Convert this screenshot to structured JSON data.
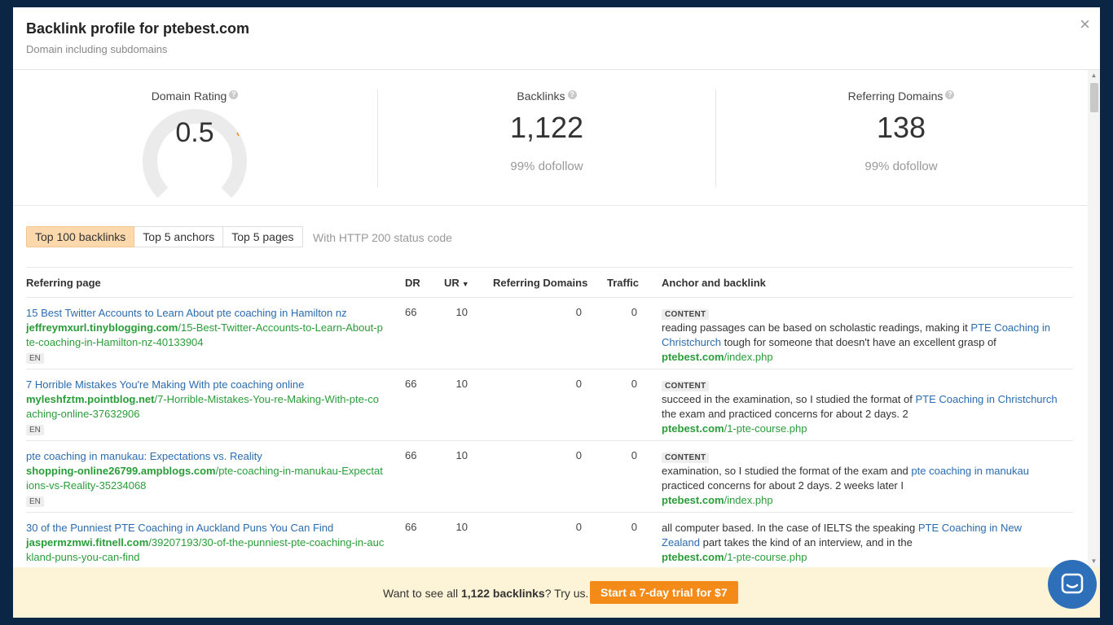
{
  "header": {
    "title": "Backlink profile for ptebest.com",
    "subtitle": "Domain including subdomains",
    "close_icon": "×"
  },
  "metrics": {
    "domain_rating": {
      "label": "Domain Rating",
      "value": "0.5",
      "gauge_fraction": 0.005
    },
    "backlinks": {
      "label": "Backlinks",
      "value": "1,122",
      "sub": "99% dofollow"
    },
    "referring_domains": {
      "label": "Referring Domains",
      "value": "138",
      "sub": "99% dofollow"
    },
    "help_glyph": "?"
  },
  "tabs": [
    {
      "label": "Top 100 backlinks",
      "active": true
    },
    {
      "label": "Top 5 anchors",
      "active": false
    },
    {
      "label": "Top 5 pages",
      "active": false
    }
  ],
  "tab_note": "With HTTP 200 status code",
  "table": {
    "headers": {
      "referring_page": "Referring page",
      "dr": "DR",
      "ur": "UR",
      "referring_domains": "Referring Domains",
      "traffic": "Traffic",
      "anchor": "Anchor and backlink"
    },
    "rows": [
      {
        "title": "15 Best Twitter Accounts to Learn About pte coaching in Hamilton nz",
        "domain": "jeffreymxurl.tinyblogging.com",
        "path": "/15-Best-Twitter-Accounts-to-Learn-About-pte-coaching-in-Hamilton-nz-40133904",
        "lang": "EN",
        "dr": "66",
        "ur": "10",
        "rd": "0",
        "traffic": "0",
        "badge": "CONTENT",
        "text_before": "reading passages can be based on scholastic readings, making it ",
        "anchor": "PTE Coaching in Christchurch",
        "text_after": " tough for someone that doesn't have an excellent grasp of",
        "bl_domain": "ptebest.com",
        "bl_path": "/index.php"
      },
      {
        "title": "7 Horrible Mistakes You're Making With pte coaching online",
        "domain": "myleshfztm.pointblog.net",
        "path": "/7-Horrible-Mistakes-You-re-Making-With-pte-coaching-online-37632906",
        "lang": "EN",
        "dr": "66",
        "ur": "10",
        "rd": "0",
        "traffic": "0",
        "badge": "CONTENT",
        "text_before": "succeed in the examination, so I studied the format of ",
        "anchor": "PTE Coaching in Christchurch",
        "text_after": " the exam and practiced concerns for about 2 days. 2",
        "bl_domain": "ptebest.com",
        "bl_path": "/1-pte-course.php"
      },
      {
        "title": "pte coaching in manukau: Expectations vs. Reality",
        "domain": "shopping-online26799.ampblogs.com",
        "path": "/pte-coaching-in-manukau-Expectations-vs-Reality-35234068",
        "lang": "EN",
        "dr": "66",
        "ur": "10",
        "rd": "0",
        "traffic": "0",
        "badge": "CONTENT",
        "text_before": "examination, so I studied the format of the exam and ",
        "anchor": "pte coaching in manukau",
        "text_after": " practiced concerns for about 2 days. 2 weeks later I",
        "bl_domain": "ptebest.com",
        "bl_path": "/index.php"
      },
      {
        "title": "30 of the Punniest PTE Coaching in Auckland Puns You Can Find",
        "domain": "jaspermzmwi.fitnell.com",
        "path": "/39207193/30-of-the-punniest-pte-coaching-in-auckland-puns-you-can-find",
        "lang": "",
        "dr": "66",
        "ur": "10",
        "rd": "0",
        "traffic": "0",
        "badge": "",
        "text_before": "all computer based. In the case of IELTS the speaking ",
        "anchor": "PTE Coaching in New Zealand",
        "text_after": " part takes the kind of an interview, and in the",
        "bl_domain": "ptebest.com",
        "bl_path": "/1-pte-course.php"
      }
    ]
  },
  "footer": {
    "text_prefix": "Want to see all ",
    "count": "1,122 backlinks",
    "text_suffix": "? Try us.",
    "cta": "Start a 7-day trial for $7"
  },
  "colors": {
    "accent": "#f48a18",
    "link": "#2b6cb0",
    "url_green": "#2a9d3a",
    "active_tab": "#fcd8ad",
    "footer_bg": "#fdf3d6",
    "chat": "#2d6fb9"
  },
  "icons": {
    "close": "close-icon",
    "help": "help-icon",
    "sort": "sort-down-icon",
    "chat": "chat-icon"
  }
}
